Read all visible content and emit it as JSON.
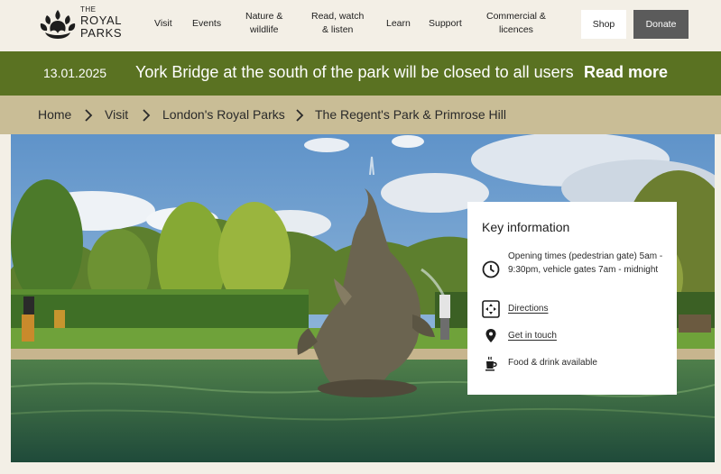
{
  "logo": {
    "line1": "THE",
    "line2": "ROYAL",
    "line3": "PARKS"
  },
  "nav": [
    {
      "label": "Visit"
    },
    {
      "label": "Events"
    },
    {
      "label": "Nature &\nwildlife"
    },
    {
      "label": "Read, watch\n& listen"
    },
    {
      "label": "Learn"
    },
    {
      "label": "Support"
    },
    {
      "label": "Commercial &\nlicences"
    }
  ],
  "header_buttons": {
    "shop": "Shop",
    "donate": "Donate"
  },
  "alert": {
    "date": "13.01.2025",
    "text": "York Bridge at the south of the park will be closed to all users",
    "read_more": "Read more"
  },
  "breadcrumb": [
    "Home",
    "Visit",
    "London's Royal Parks",
    "The Regent's Park & Primrose Hill"
  ],
  "key_info": {
    "title": "Key information",
    "opening": "Opening times (pedestrian gate) 5am - 9:30pm, vehicle gates 7am - midnight",
    "directions": "Directions",
    "contact": "Get in touch",
    "food": "Food & drink available"
  },
  "colors": {
    "header_bg": "#f3efe6",
    "alert_bg": "#5a7222",
    "breadcrumb_bg": "#c9bd96",
    "donate_bg": "#5b5b5b"
  },
  "icons": [
    "royal-parks-crest-icon",
    "chevron-right-icon",
    "clock-icon",
    "directions-icon",
    "location-pin-icon",
    "coffee-cup-icon"
  ]
}
